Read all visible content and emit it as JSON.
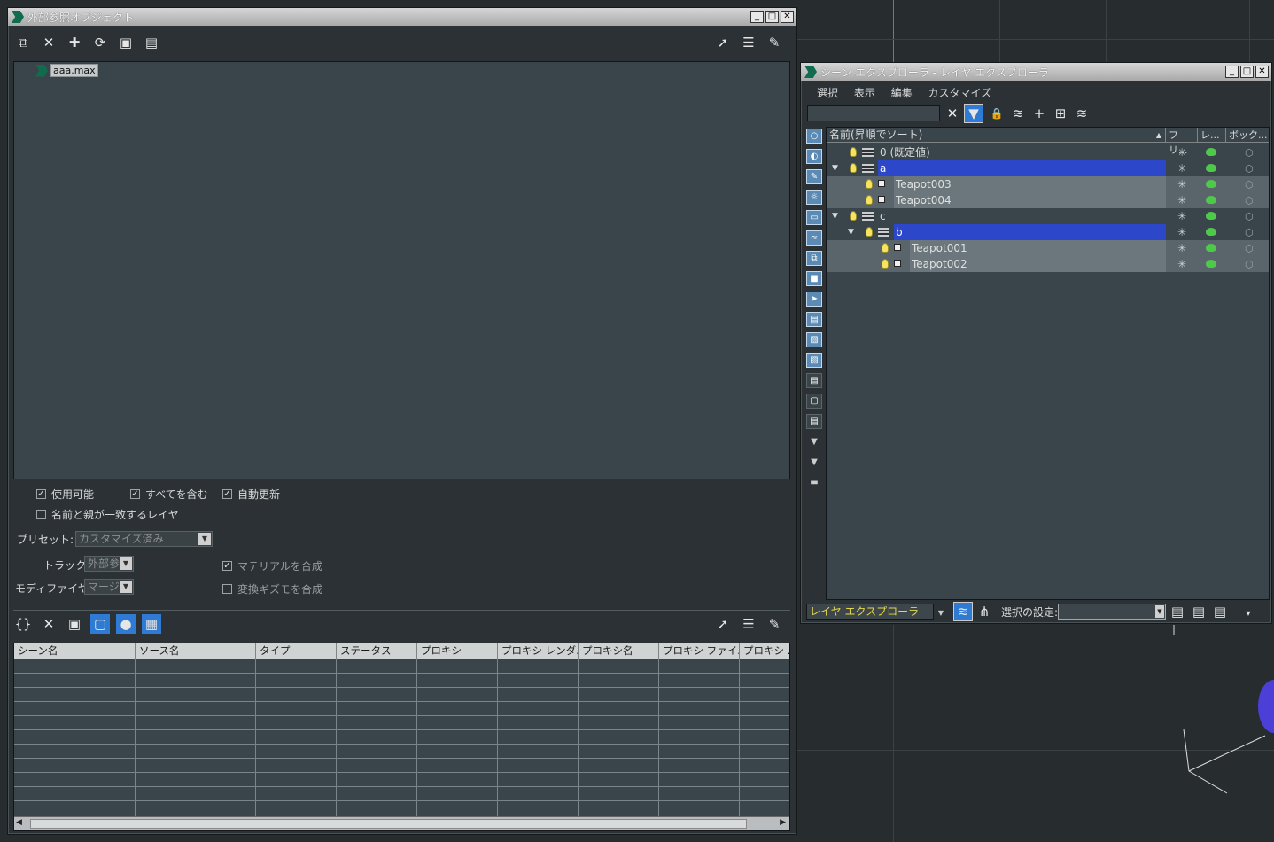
{
  "xref_window": {
    "title": "外部参照オブジェクト",
    "tree_item": "aaa.max",
    "options": {
      "enabled": "使用可能",
      "include_all": "すべてを含む",
      "auto_update": "自動更新",
      "name_parent_layer": "名前と親が一致するレイヤ",
      "preset_label": "プリセット:",
      "preset_value": "カスタマイズ済み",
      "track_label": "トラック:",
      "track_value": "外部参",
      "modifier_label": "モディファイヤ :",
      "modifier_value": "マージ",
      "merge_material": "マテリアルを合成",
      "merge_gizmo": "変換ギズモを合成"
    },
    "table_headers": [
      "シーン名",
      "ソース名",
      "タイプ",
      "ステータス",
      "プロキシ",
      "プロキシ レンダ...",
      "プロキシ名",
      "プロキシ ファイ...",
      "プロキシ ..."
    ]
  },
  "scene_explorer": {
    "title": "シーン エクスプローラ - レイヤ エクスプローラ",
    "menu": [
      "選択",
      "表示",
      "編集",
      "カスタマイズ"
    ],
    "columns": {
      "name": "名前(昇順でソート)",
      "freeze": "フリ...",
      "render": "レ...",
      "box": "ボック..."
    },
    "rows": [
      {
        "label": "0 (既定値)",
        "indent": 0,
        "kind": "layer",
        "state": "normal"
      },
      {
        "label": "a",
        "indent": 0,
        "kind": "layer",
        "state": "selected",
        "expand": "▼"
      },
      {
        "label": "Teapot003",
        "indent": 1,
        "kind": "object",
        "state": "child"
      },
      {
        "label": "Teapot004",
        "indent": 1,
        "kind": "object",
        "state": "child"
      },
      {
        "label": "c",
        "indent": 0,
        "kind": "layer",
        "state": "normal",
        "expand": "▼"
      },
      {
        "label": "b",
        "indent": 1,
        "kind": "layer",
        "state": "selected",
        "expand": "▼"
      },
      {
        "label": "Teapot001",
        "indent": 2,
        "kind": "object",
        "state": "child"
      },
      {
        "label": "Teapot002",
        "indent": 2,
        "kind": "object",
        "state": "child"
      }
    ],
    "footer": {
      "explorer_name": "レイヤ エクスプローラ",
      "selection_set_label": "選択の設定:"
    }
  }
}
